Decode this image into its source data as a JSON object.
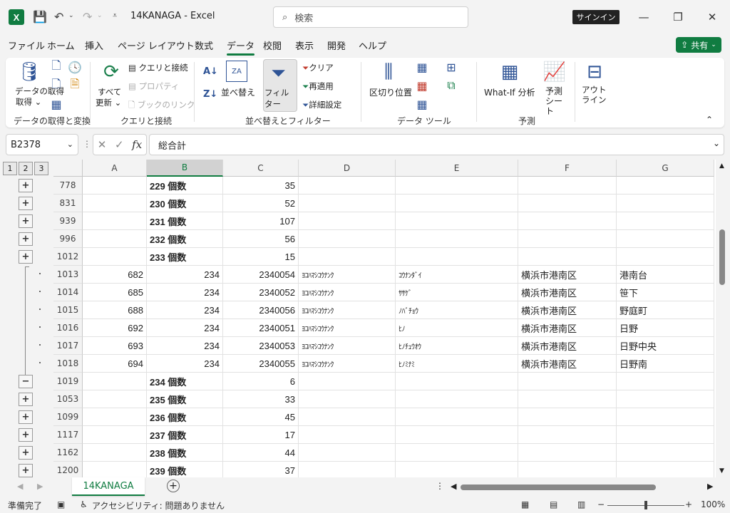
{
  "app": {
    "title": "14KANAGA  -  Excel",
    "logo": "X",
    "search_placeholder": "検索",
    "signin_label": "サインイン",
    "share_label": "共有"
  },
  "menu": [
    "ファイル",
    "ホーム",
    "挿入",
    "ページ レイアウト",
    "数式",
    "データ",
    "校閲",
    "表示",
    "開発",
    "ヘルプ"
  ],
  "active_menu": "データ",
  "ribbon": {
    "get_data_label": "データの取得",
    "group_get_transform": "データの取得と変換",
    "refresh_all_label": "すべて更新",
    "queries_connections": "クエリと接続",
    "properties": "プロパティ",
    "edit_links": "ブックのリンク",
    "group_queries": "クエリと接続",
    "sort_label": "並べ替え",
    "filter_label": "フィルター",
    "clear_label": "クリア",
    "reapply_label": "再適用",
    "advanced_label": "詳細設定",
    "group_sort_filter": "並べ替えとフィルター",
    "text_to_columns": "区切り位置",
    "group_data_tools": "データ ツール",
    "whatif_label": "What-If 分析",
    "forecast_label": "予測シート",
    "group_forecast": "予測",
    "outline_label": "アウトライン"
  },
  "formula_bar": {
    "name_box": "B2378",
    "formula": "総合計"
  },
  "columns": [
    "A",
    "B",
    "C",
    "D",
    "E",
    "F",
    "G"
  ],
  "selected_column": "B",
  "outline_levels": [
    "1",
    "2",
    "3"
  ],
  "rows": [
    {
      "num": "778",
      "outline": "+",
      "A": "",
      "B": "229 個数",
      "C": "35",
      "D": "",
      "E": "",
      "F": "",
      "G": "",
      "subtotal": true
    },
    {
      "num": "831",
      "outline": "+",
      "A": "",
      "B": "230 個数",
      "C": "52",
      "D": "",
      "E": "",
      "F": "",
      "G": "",
      "subtotal": true
    },
    {
      "num": "939",
      "outline": "+",
      "A": "",
      "B": "231 個数",
      "C": "107",
      "D": "",
      "E": "",
      "F": "",
      "G": "",
      "subtotal": true
    },
    {
      "num": "996",
      "outline": "+",
      "A": "",
      "B": "232 個数",
      "C": "56",
      "D": "",
      "E": "",
      "F": "",
      "G": "",
      "subtotal": true
    },
    {
      "num": "1012",
      "outline": "+",
      "A": "",
      "B": "233 個数",
      "C": "15",
      "D": "",
      "E": "",
      "F": "",
      "G": "",
      "subtotal": true
    },
    {
      "num": "1013",
      "outline": "·",
      "A": "682",
      "B": "234",
      "C": "2340054",
      "D": "ﾖｺﾊﾏｼｺｳﾅﾝｸ",
      "E": "ｺｳﾅﾝﾀﾞｲ",
      "F": "横浜市港南区",
      "G": "港南台",
      "subtotal": false
    },
    {
      "num": "1014",
      "outline": "·",
      "A": "685",
      "B": "234",
      "C": "2340052",
      "D": "ﾖｺﾊﾏｼｺｳﾅﾝｸ",
      "E": "ｻｻｹﾞ",
      "F": "横浜市港南区",
      "G": "笹下",
      "subtotal": false
    },
    {
      "num": "1015",
      "outline": "·",
      "A": "688",
      "B": "234",
      "C": "2340056",
      "D": "ﾖｺﾊﾏｼｺｳﾅﾝｸ",
      "E": "ﾉﾊﾞﾁｮｳ",
      "F": "横浜市港南区",
      "G": "野庭町",
      "subtotal": false
    },
    {
      "num": "1016",
      "outline": "·",
      "A": "692",
      "B": "234",
      "C": "2340051",
      "D": "ﾖｺﾊﾏｼｺｳﾅﾝｸ",
      "E": "ﾋﾉ",
      "F": "横浜市港南区",
      "G": "日野",
      "subtotal": false
    },
    {
      "num": "1017",
      "outline": "·",
      "A": "693",
      "B": "234",
      "C": "2340053",
      "D": "ﾖｺﾊﾏｼｺｳﾅﾝｸ",
      "E": "ﾋﾉﾁｭｳｵｳ",
      "F": "横浜市港南区",
      "G": "日野中央",
      "subtotal": false
    },
    {
      "num": "1018",
      "outline": "·",
      "A": "694",
      "B": "234",
      "C": "2340055",
      "D": "ﾖｺﾊﾏｼｺｳﾅﾝｸ",
      "E": "ﾋﾉﾐﾅﾐ",
      "F": "横浜市港南区",
      "G": "日野南",
      "subtotal": false
    },
    {
      "num": "1019",
      "outline": "−",
      "A": "",
      "B": "234 個数",
      "C": "6",
      "D": "",
      "E": "",
      "F": "",
      "G": "",
      "subtotal": true
    },
    {
      "num": "1053",
      "outline": "+",
      "A": "",
      "B": "235 個数",
      "C": "33",
      "D": "",
      "E": "",
      "F": "",
      "G": "",
      "subtotal": true
    },
    {
      "num": "1099",
      "outline": "+",
      "A": "",
      "B": "236 個数",
      "C": "45",
      "D": "",
      "E": "",
      "F": "",
      "G": "",
      "subtotal": true
    },
    {
      "num": "1117",
      "outline": "+",
      "A": "",
      "B": "237 個数",
      "C": "17",
      "D": "",
      "E": "",
      "F": "",
      "G": "",
      "subtotal": true
    },
    {
      "num": "1162",
      "outline": "+",
      "A": "",
      "B": "238 個数",
      "C": "44",
      "D": "",
      "E": "",
      "F": "",
      "G": "",
      "subtotal": true
    },
    {
      "num": "1200",
      "outline": "+",
      "A": "",
      "B": "239 個数",
      "C": "37",
      "D": "",
      "E": "",
      "F": "",
      "G": "",
      "subtotal": true
    }
  ],
  "sheet_tab": "14KANAGA",
  "status": {
    "ready": "準備完了",
    "accessibility": "アクセシビリティ: 問題ありません",
    "zoom": "100%"
  },
  "colors": {
    "excel_green": "#107c41",
    "ribbon_icon_blue": "#2f5496"
  }
}
